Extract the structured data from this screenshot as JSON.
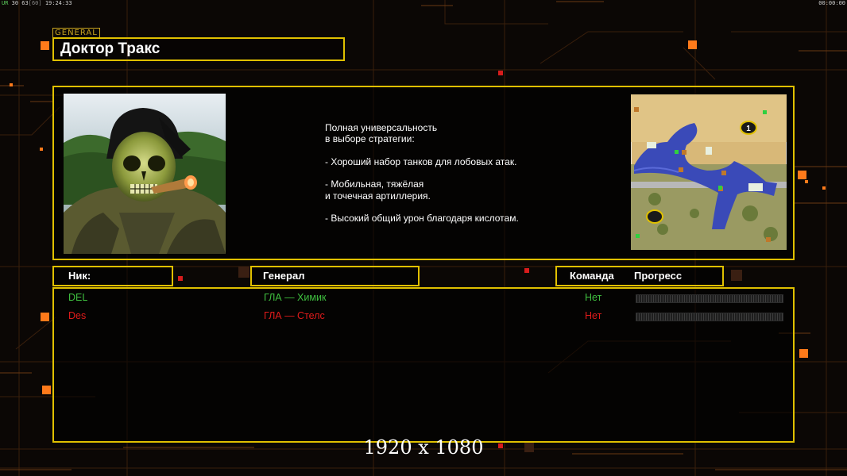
{
  "overlay": {
    "fps_label": "UR",
    "fps_value": "30 63",
    "fps_cap": "[60]",
    "time": "19:24:33",
    "game_timer": "00:00:00"
  },
  "header": {
    "tag": "GENERAL",
    "general_name": "Доктор Тракс"
  },
  "description": {
    "line1": "Полная универсальность",
    "line2": "в выборе стратегии:",
    "bullet1": "- Хороший набор танков для лобовых атак.",
    "bullet2a": "- Мобильная, тяжёлая",
    "bullet2b": "и точечная артиллерия.",
    "bullet3": "- Высокий общий урон благодаря кислотам."
  },
  "columns": {
    "nick": "Ник:",
    "general": "Генерал",
    "team": "Команда",
    "progress": "Прогресс"
  },
  "players": [
    {
      "nick": "DEL",
      "general": "ГЛА — Химик",
      "team": "Нет",
      "color": "#3fbf3f",
      "progress": 0
    },
    {
      "nick": "Des",
      "general": "ГЛА — Стелс",
      "team": "Нет",
      "color": "#e01b1b",
      "progress": 0
    }
  ],
  "minimap": {
    "start_marker": "1"
  },
  "resolution_label": "1920 x 1080",
  "colors": {
    "accent": "#e0c000",
    "background": "#0b0705",
    "circuit": "#4a2a10",
    "node": "#ff7a1a"
  }
}
